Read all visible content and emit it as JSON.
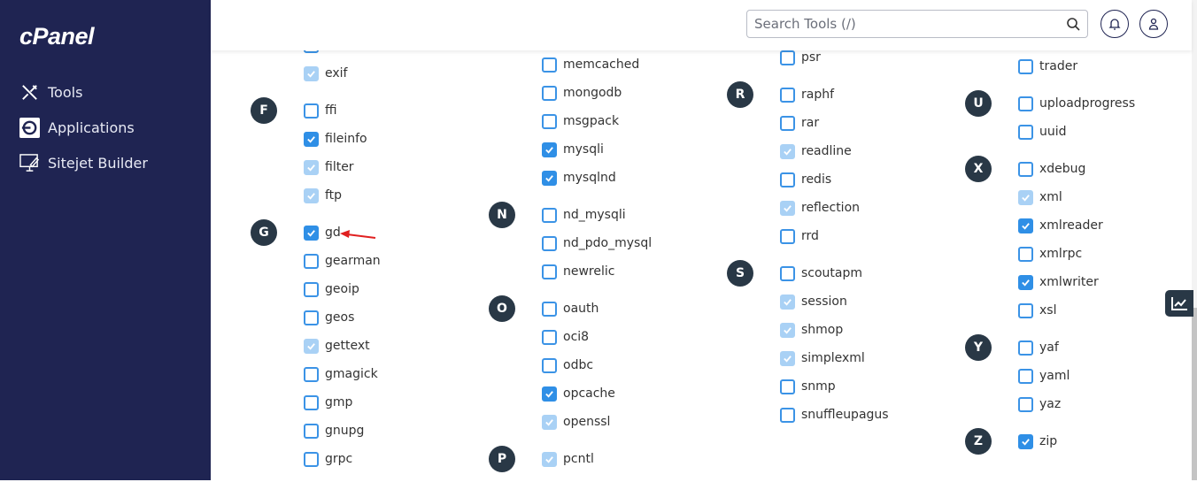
{
  "sidebar": {
    "logo": "cPanel",
    "items": [
      {
        "label": "Tools",
        "icon": "tools-icon"
      },
      {
        "label": "Applications",
        "icon": "applications-icon"
      },
      {
        "label": "Sitejet Builder",
        "icon": "sitejet-icon"
      }
    ]
  },
  "header": {
    "search_placeholder": "Search Tools (/)"
  },
  "colors": {
    "sidebar": "#1f2452",
    "checked": "#2f8fe6",
    "disabled": "#a9d1f5",
    "letter": "#293846",
    "arrow": "#e02020"
  },
  "columns": [
    {
      "groups": [
        {
          "letter": "",
          "items": [
            {
              "name": "",
              "state": "unchecked"
            },
            {
              "name": "exif",
              "state": "disabled"
            }
          ]
        },
        {
          "letter": "F",
          "items": [
            {
              "name": "ffi",
              "state": "unchecked"
            },
            {
              "name": "fileinfo",
              "state": "checked"
            },
            {
              "name": "filter",
              "state": "disabled"
            },
            {
              "name": "ftp",
              "state": "disabled"
            }
          ]
        },
        {
          "letter": "G",
          "items": [
            {
              "name": "gd",
              "state": "checked"
            },
            {
              "name": "gearman",
              "state": "unchecked"
            },
            {
              "name": "geoip",
              "state": "unchecked"
            },
            {
              "name": "geos",
              "state": "unchecked"
            },
            {
              "name": "gettext",
              "state": "disabled"
            },
            {
              "name": "gmagick",
              "state": "unchecked"
            },
            {
              "name": "gmp",
              "state": "unchecked"
            },
            {
              "name": "gnupg",
              "state": "unchecked"
            },
            {
              "name": "grpc",
              "state": "unchecked"
            }
          ]
        }
      ]
    },
    {
      "groups": [
        {
          "letter": "",
          "items": [
            {
              "name": "memcached",
              "state": "unchecked"
            },
            {
              "name": "mongodb",
              "state": "unchecked"
            },
            {
              "name": "msgpack",
              "state": "unchecked"
            },
            {
              "name": "mysqli",
              "state": "checked"
            },
            {
              "name": "mysqlnd",
              "state": "checked"
            }
          ]
        },
        {
          "letter": "N",
          "items": [
            {
              "name": "nd_mysqli",
              "state": "unchecked"
            },
            {
              "name": "nd_pdo_mysql",
              "state": "unchecked"
            },
            {
              "name": "newrelic",
              "state": "unchecked"
            }
          ]
        },
        {
          "letter": "O",
          "items": [
            {
              "name": "oauth",
              "state": "unchecked"
            },
            {
              "name": "oci8",
              "state": "unchecked"
            },
            {
              "name": "odbc",
              "state": "unchecked"
            },
            {
              "name": "opcache",
              "state": "checked"
            },
            {
              "name": "openssl",
              "state": "disabled"
            }
          ]
        },
        {
          "letter": "P",
          "items": [
            {
              "name": "pcntl",
              "state": "disabled"
            }
          ]
        }
      ]
    },
    {
      "groups": [
        {
          "letter": "",
          "items": [
            {
              "name": "psr",
              "state": "unchecked"
            }
          ]
        },
        {
          "letter": "R",
          "items": [
            {
              "name": "raphf",
              "state": "unchecked"
            },
            {
              "name": "rar",
              "state": "unchecked"
            },
            {
              "name": "readline",
              "state": "disabled"
            },
            {
              "name": "redis",
              "state": "unchecked"
            },
            {
              "name": "reflection",
              "state": "disabled"
            },
            {
              "name": "rrd",
              "state": "unchecked"
            }
          ]
        },
        {
          "letter": "S",
          "items": [
            {
              "name": "scoutapm",
              "state": "unchecked"
            },
            {
              "name": "session",
              "state": "disabled"
            },
            {
              "name": "shmop",
              "state": "disabled"
            },
            {
              "name": "simplexml",
              "state": "disabled"
            },
            {
              "name": "snmp",
              "state": "unchecked"
            },
            {
              "name": "snuffleupagus",
              "state": "unchecked"
            }
          ]
        }
      ]
    },
    {
      "groups": [
        {
          "letter": "",
          "items": [
            {
              "name": "trader",
              "state": "unchecked"
            }
          ]
        },
        {
          "letter": "U",
          "items": [
            {
              "name": "uploadprogress",
              "state": "unchecked"
            },
            {
              "name": "uuid",
              "state": "unchecked"
            }
          ]
        },
        {
          "letter": "X",
          "items": [
            {
              "name": "xdebug",
              "state": "unchecked"
            },
            {
              "name": "xml",
              "state": "disabled"
            },
            {
              "name": "xmlreader",
              "state": "checked"
            },
            {
              "name": "xmlrpc",
              "state": "unchecked"
            },
            {
              "name": "xmlwriter",
              "state": "checked"
            },
            {
              "name": "xsl",
              "state": "unchecked"
            }
          ]
        },
        {
          "letter": "Y",
          "items": [
            {
              "name": "yaf",
              "state": "unchecked"
            },
            {
              "name": "yaml",
              "state": "unchecked"
            },
            {
              "name": "yaz",
              "state": "unchecked"
            }
          ]
        },
        {
          "letter": "Z",
          "items": [
            {
              "name": "zip",
              "state": "checked"
            }
          ]
        }
      ]
    }
  ]
}
